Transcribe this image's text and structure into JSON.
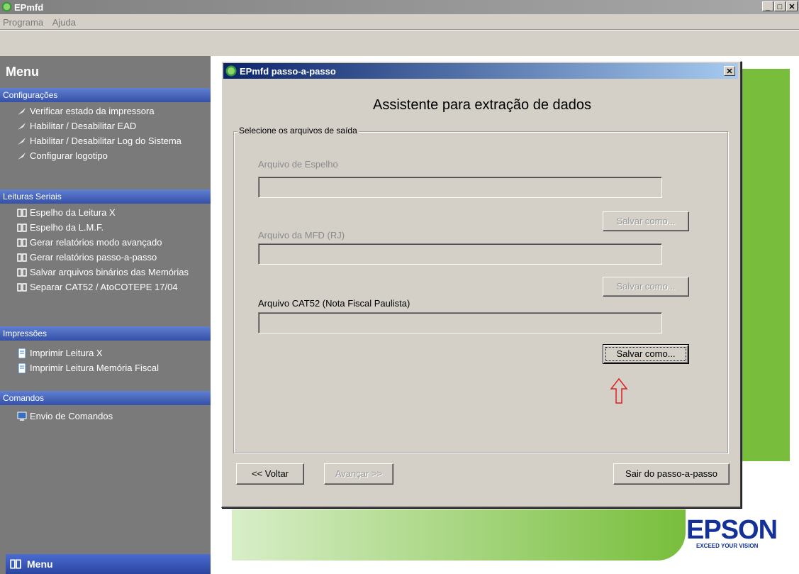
{
  "window": {
    "title": "EPmfd",
    "min_glyph": "_",
    "max_glyph": "□",
    "close_glyph": "✕"
  },
  "menubar": {
    "items": [
      "Programa",
      "Ajuda"
    ]
  },
  "sidebar": {
    "header": "Menu",
    "sections": [
      {
        "title": "Configurações",
        "items": [
          "Verificar estado da impressora",
          "Habilitar / Desabilitar EAD",
          "Habilitar / Desabilitar Log do Sistema",
          "Configurar logotipo"
        ]
      },
      {
        "title": "Leituras Seriais",
        "items": [
          "Espelho da Leitura X",
          "Espelho da L.M.F.",
          "Gerar relatórios modo avançado",
          "Gerar relatórios passo-a-passo",
          "Salvar arquivos binários das Memórias",
          "Separar CAT52 / AtoCOTEPE 17/04"
        ]
      },
      {
        "title": "Impressões",
        "items": [
          "Imprimir Leitura X",
          "Imprimir Leitura Memória Fiscal"
        ]
      },
      {
        "title": "Comandos",
        "items": [
          "Envio de Comandos"
        ]
      }
    ],
    "footer": "Menu"
  },
  "dialog": {
    "title": "EPmfd passo-a-passo",
    "close_glyph": "✕",
    "heading": "Assistente para extração de dados",
    "group_label": "Selecione os arquivos de saída",
    "fields": [
      {
        "label": "Arquivo de Espelho",
        "value": "",
        "button": "Salvar como..."
      },
      {
        "label": "Arquivo da MFD (RJ)",
        "value": "",
        "button": "Salvar como..."
      },
      {
        "label": "Arquivo CAT52 (Nota Fiscal Paulista)",
        "value": "",
        "button": "Salvar como..."
      }
    ],
    "back_button": "<< Voltar",
    "next_button": "Avançar >>",
    "exit_button": "Sair do passo-a-passo"
  },
  "brand": {
    "name": "EPSON",
    "tagline": "EXCEED YOUR VISION"
  },
  "colors": {
    "accent_green": "#78be3c",
    "section_blue": "#3550a8",
    "arrow_red": "#e02020",
    "brand_blue": "#14319a"
  }
}
